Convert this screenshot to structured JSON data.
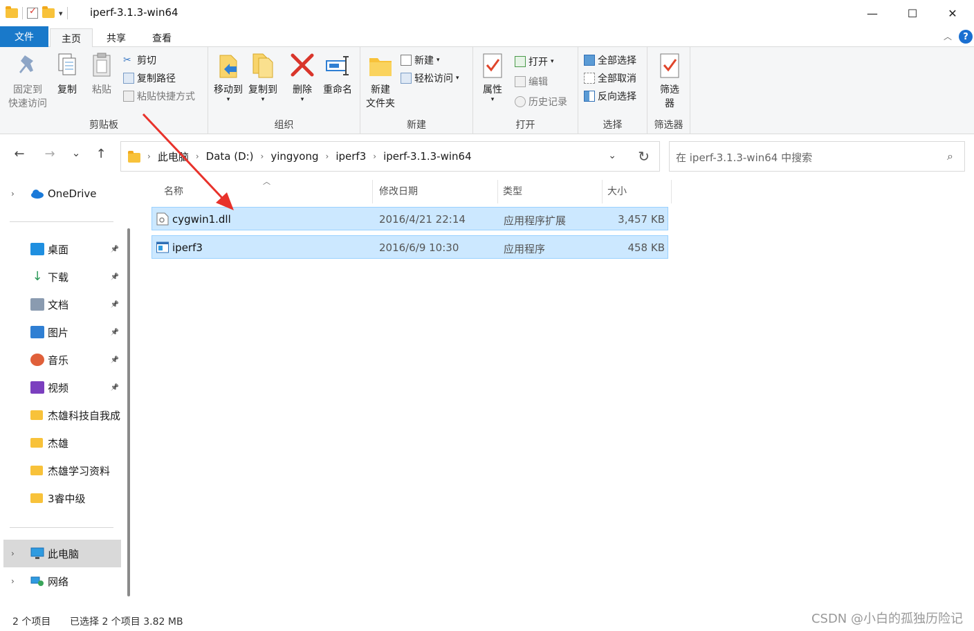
{
  "window": {
    "title": "iperf-3.1.3-win64",
    "minimize": "—",
    "maximize": "☐",
    "close": "✕"
  },
  "ribbon_tabs": {
    "file": "文件",
    "home": "主页",
    "share": "共享",
    "view": "查看"
  },
  "ribbon": {
    "clipboard": {
      "label": "剪贴板",
      "pin_quick_access": "固定到\n快速访问",
      "copy": "复制",
      "paste": "粘贴",
      "cut": "剪切",
      "copy_path": "复制路径",
      "paste_shortcut": "粘贴快捷方式"
    },
    "organize": {
      "label": "组织",
      "move_to": "移动到",
      "copy_to": "复制到",
      "delete": "删除",
      "rename": "重命名"
    },
    "new": {
      "label": "新建",
      "new_folder": "新建\n文件夹",
      "new_item": "新建",
      "easy_access": "轻松访问"
    },
    "open": {
      "label": "打开",
      "properties": "属性",
      "open": "打开",
      "edit": "编辑",
      "history": "历史记录"
    },
    "select": {
      "label": "选择",
      "select_all": "全部选择",
      "select_none": "全部取消",
      "invert": "反向选择"
    },
    "filter": {
      "label": "筛选器",
      "filter_btn": "筛选\n器"
    }
  },
  "nav": {
    "back": "←",
    "forward": "→",
    "recent": "⌄",
    "up": "↑"
  },
  "address": {
    "crumbs": [
      "此电脑",
      "Data (D:)",
      "yingyong",
      "iperf3",
      "iperf-3.1.3-win64"
    ],
    "sep": "›"
  },
  "search": {
    "placeholder": "在 iperf-3.1.3-win64 中搜索"
  },
  "sidebar": {
    "onedrive": "OneDrive",
    "items": [
      {
        "label": "桌面",
        "icon": "desktop-icon"
      },
      {
        "label": "下载",
        "icon": "download-icon"
      },
      {
        "label": "文档",
        "icon": "document-icon"
      },
      {
        "label": "图片",
        "icon": "pictures-icon"
      },
      {
        "label": "音乐",
        "icon": "music-icon"
      },
      {
        "label": "视频",
        "icon": "video-icon"
      },
      {
        "label": "杰雄科技自我成",
        "icon": "folder-icon"
      },
      {
        "label": "杰雄",
        "icon": "folder-icon"
      },
      {
        "label": "杰雄学习资料",
        "icon": "folder-icon"
      },
      {
        "label": "3睿中级",
        "icon": "folder-icon"
      }
    ],
    "this_pc": "此电脑",
    "network": "网络"
  },
  "columns": {
    "name": "名称",
    "date": "修改日期",
    "type": "类型",
    "size": "大小"
  },
  "files": [
    {
      "name": "cygwin1.dll",
      "date": "2016/4/21 22:14",
      "type": "应用程序扩展",
      "size": "3,457 KB"
    },
    {
      "name": "iperf3",
      "date": "2016/6/9 10:30",
      "type": "应用程序",
      "size": "458 KB"
    }
  ],
  "status": {
    "count": "2 个项目",
    "selected": "已选择 2 个项目  3.82 MB"
  },
  "watermark": "CSDN @小白的孤独历险记",
  "colors": {
    "accent": "#1979ca",
    "selection": "#cce8ff",
    "annotation": "#e8322b"
  }
}
